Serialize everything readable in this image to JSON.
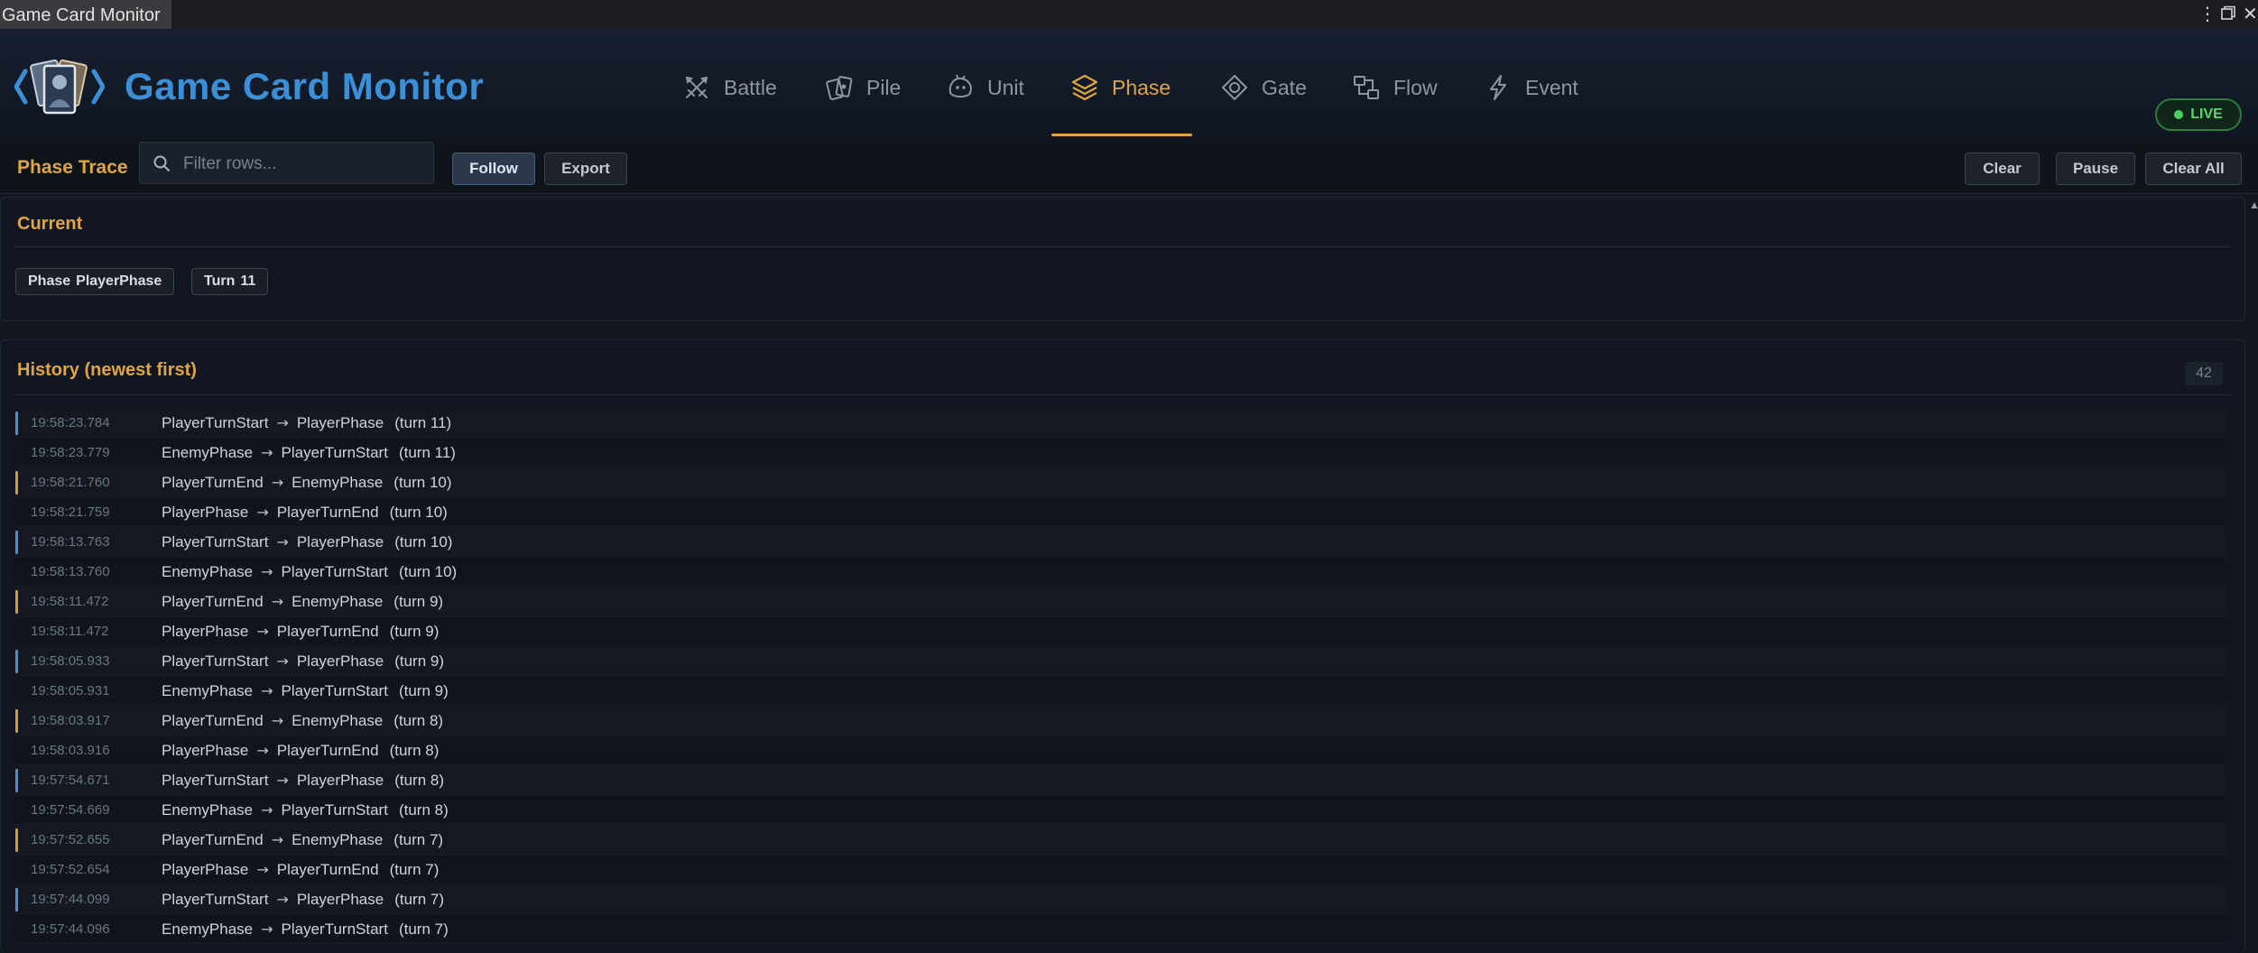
{
  "window": {
    "title": "Game Card Monitor"
  },
  "header": {
    "title": "Game Card Monitor",
    "live_label": "LIVE",
    "colors": {
      "accent": "#e0a541",
      "brand": "#3b8fd6",
      "live": "#4bd160"
    },
    "tabs": [
      {
        "label": "Battle",
        "icon": "crossed-swords-icon",
        "active": false
      },
      {
        "label": "Pile",
        "icon": "cards-icon",
        "active": false
      },
      {
        "label": "Unit",
        "icon": "creature-icon",
        "active": false
      },
      {
        "label": "Phase",
        "icon": "layers-icon",
        "active": true
      },
      {
        "label": "Gate",
        "icon": "diamond-gate-icon",
        "active": false
      },
      {
        "label": "Flow",
        "icon": "flow-icon",
        "active": false
      },
      {
        "label": "Event",
        "icon": "lightning-icon",
        "active": false
      }
    ]
  },
  "toolbar": {
    "title": "Phase Trace",
    "filter_placeholder": "Filter rows...",
    "follow_label": "Follow",
    "export_label": "Export",
    "clear_label": "Clear",
    "pause_label": "Pause",
    "clear_all_label": "Clear All"
  },
  "current": {
    "title": "Current",
    "phase_label": "Phase",
    "phase_value": "PlayerPhase",
    "turn_label": "Turn",
    "turn_value": "11"
  },
  "history": {
    "title": "History (newest first)",
    "count": "42",
    "rows": [
      {
        "time": "19:58:23.784",
        "from": "PlayerTurnStart",
        "to": "PlayerPhase",
        "turn": "(turn 11)",
        "marker": "blue"
      },
      {
        "time": "19:58:23.779",
        "from": "EnemyPhase",
        "to": "PlayerTurnStart",
        "turn": "(turn 11)",
        "marker": "none"
      },
      {
        "time": "19:58:21.760",
        "from": "PlayerTurnEnd",
        "to": "EnemyPhase",
        "turn": "(turn 10)",
        "marker": "amber"
      },
      {
        "time": "19:58:21.759",
        "from": "PlayerPhase",
        "to": "PlayerTurnEnd",
        "turn": "(turn 10)",
        "marker": "none"
      },
      {
        "time": "19:58:13.763",
        "from": "PlayerTurnStart",
        "to": "PlayerPhase",
        "turn": "(turn 10)",
        "marker": "blue"
      },
      {
        "time": "19:58:13.760",
        "from": "EnemyPhase",
        "to": "PlayerTurnStart",
        "turn": "(turn 10)",
        "marker": "none"
      },
      {
        "time": "19:58:11.472",
        "from": "PlayerTurnEnd",
        "to": "EnemyPhase",
        "turn": "(turn 9)",
        "marker": "amber"
      },
      {
        "time": "19:58:11.472",
        "from": "PlayerPhase",
        "to": "PlayerTurnEnd",
        "turn": "(turn 9)",
        "marker": "none"
      },
      {
        "time": "19:58:05.933",
        "from": "PlayerTurnStart",
        "to": "PlayerPhase",
        "turn": "(turn 9)",
        "marker": "blue"
      },
      {
        "time": "19:58:05.931",
        "from": "EnemyPhase",
        "to": "PlayerTurnStart",
        "turn": "(turn 9)",
        "marker": "none"
      },
      {
        "time": "19:58:03.917",
        "from": "PlayerTurnEnd",
        "to": "EnemyPhase",
        "turn": "(turn 8)",
        "marker": "amber"
      },
      {
        "time": "19:58:03.916",
        "from": "PlayerPhase",
        "to": "PlayerTurnEnd",
        "turn": "(turn 8)",
        "marker": "none"
      },
      {
        "time": "19:57:54.671",
        "from": "PlayerTurnStart",
        "to": "PlayerPhase",
        "turn": "(turn 8)",
        "marker": "blue"
      },
      {
        "time": "19:57:54.669",
        "from": "EnemyPhase",
        "to": "PlayerTurnStart",
        "turn": "(turn 8)",
        "marker": "none"
      },
      {
        "time": "19:57:52.655",
        "from": "PlayerTurnEnd",
        "to": "EnemyPhase",
        "turn": "(turn 7)",
        "marker": "amber"
      },
      {
        "time": "19:57:52.654",
        "from": "PlayerPhase",
        "to": "PlayerTurnEnd",
        "turn": "(turn 7)",
        "marker": "none"
      },
      {
        "time": "19:57:44.099",
        "from": "PlayerTurnStart",
        "to": "PlayerPhase",
        "turn": "(turn 7)",
        "marker": "blue"
      },
      {
        "time": "19:57:44.096",
        "from": "EnemyPhase",
        "to": "PlayerTurnStart",
        "turn": "(turn 7)",
        "marker": "none"
      }
    ]
  }
}
